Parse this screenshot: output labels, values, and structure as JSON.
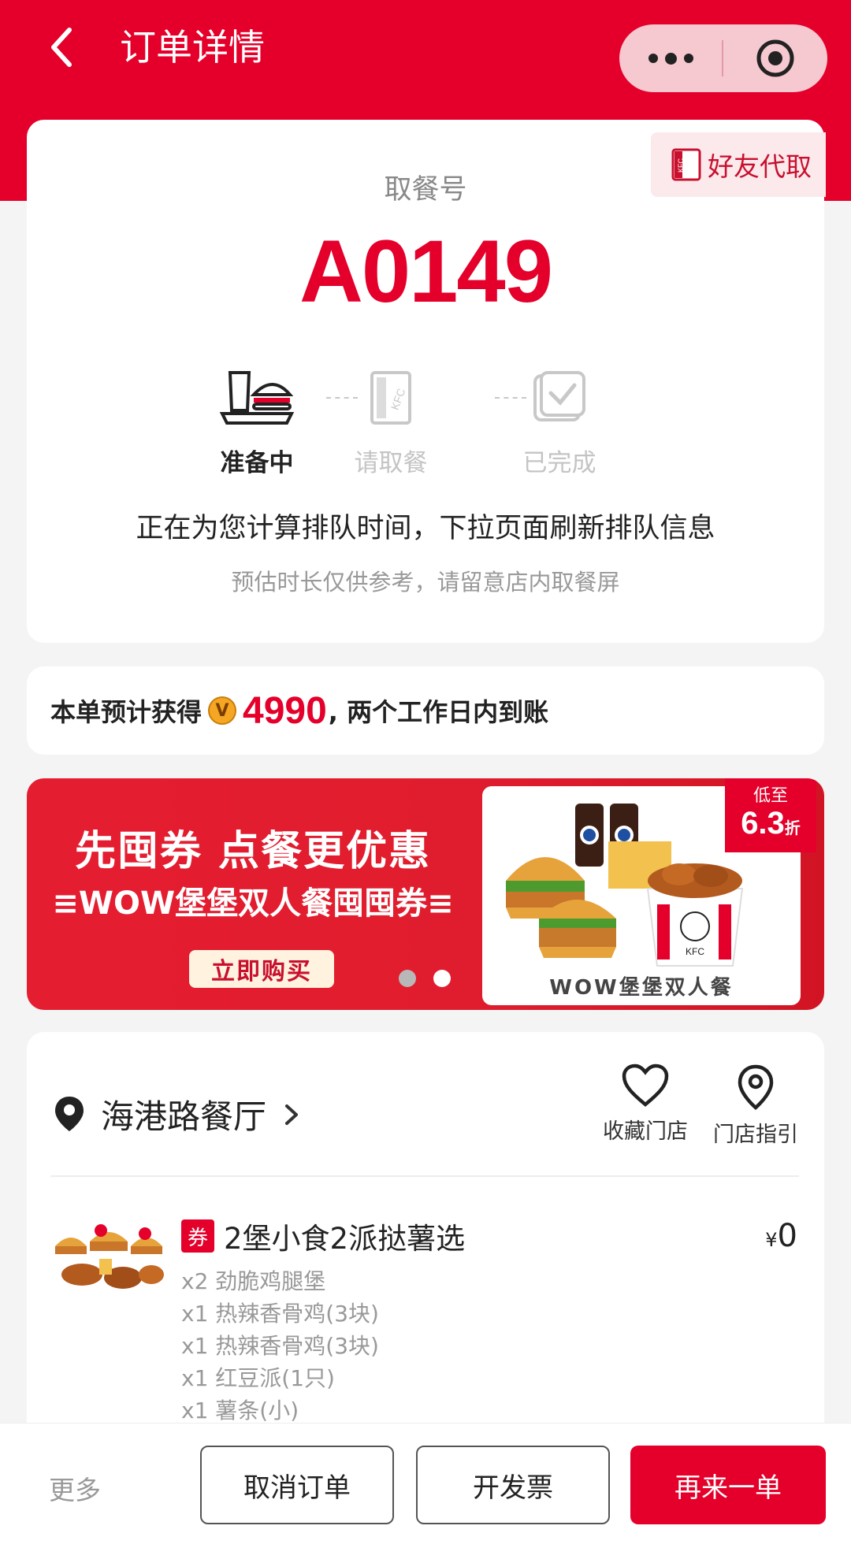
{
  "header": {
    "title": "订单详情"
  },
  "pickup": {
    "friend_pickup_label": "好友代取",
    "label": "取餐号",
    "number": "A0149",
    "steps": [
      {
        "label": "准备中",
        "icon": "burger-tray-icon",
        "state": "active"
      },
      {
        "label": "请取餐",
        "icon": "kfc-bag-icon",
        "state": "inactive"
      },
      {
        "label": "已完成",
        "icon": "check-box-icon",
        "state": "inactive"
      }
    ],
    "queue_main": "正在为您计算排队时间，下拉页面刷新排队信息",
    "queue_sub": "预估时长仅供参考，请留意店内取餐屏"
  },
  "points": {
    "prefix": "本单预计获得",
    "badge": "V",
    "value": "4990",
    "suffix": ", 两个工作日内到账"
  },
  "banner": {
    "title": "先囤券 点餐更优惠",
    "subtitle": "≡WOW堡堡双人餐囤囤券≡",
    "buy_label": "立即购买",
    "discount_line1": "低至",
    "discount_value": "6.3",
    "discount_unit": "折",
    "photo_caption": "WOW堡堡双人餐",
    "slide_count": 2,
    "active_slide": 2
  },
  "store": {
    "name": "海港路餐厅",
    "favorite_label": "收藏门店",
    "guide_label": "门店指引"
  },
  "order_item": {
    "coupon_tag": "券",
    "title": "2堡小食2派挞薯选",
    "currency": "¥",
    "price": "0",
    "sub_items": [
      "x2 劲脆鸡腿堡",
      "x1 热辣香骨鸡(3块)",
      "x1 热辣香骨鸡(3块)",
      "x1 红豆派(1只)",
      "x1 薯条(小)"
    ]
  },
  "bottom_bar": {
    "more_label": "更多",
    "cancel_label": "取消订单",
    "invoice_label": "开发票",
    "reorder_label": "再来一单"
  },
  "colors": {
    "brand_red": "#e4002b"
  }
}
